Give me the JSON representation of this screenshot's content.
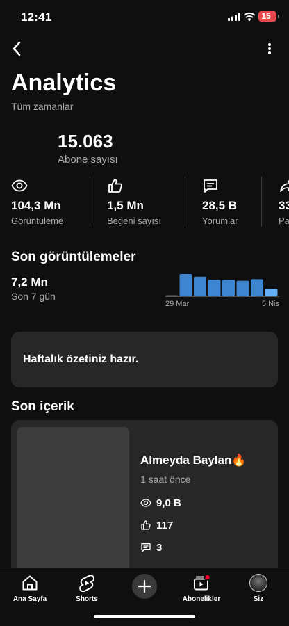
{
  "status_bar": {
    "time": "12:41",
    "battery": "15"
  },
  "header": {
    "title": "Analytics",
    "subtitle": "Tüm zamanlar"
  },
  "subscribers": {
    "value": "15.063",
    "label": "Abone sayısı"
  },
  "stats": [
    {
      "icon": "eye-icon",
      "value": "104,3 Mn",
      "label": "Görüntüleme"
    },
    {
      "icon": "thumbs-up-icon",
      "value": "1,5 Mn",
      "label": "Beğeni sayısı"
    },
    {
      "icon": "comment-icon",
      "value": "28,5 B",
      "label": "Yorumlar"
    },
    {
      "icon": "share-icon",
      "value": "33",
      "label": "Pa"
    }
  ],
  "recent_views": {
    "title": "Son görüntülemeler",
    "value": "7,2 Mn",
    "period": "Son 7 gün",
    "chart_data": {
      "type": "bar",
      "x_start_label": "29 Mar",
      "x_end_label": "5 Nis",
      "values": [
        0.05,
        1.0,
        0.88,
        0.74,
        0.74,
        0.7,
        0.77,
        0.33
      ],
      "bar_color": "#3e84cf",
      "highlight_color": "#65aef5"
    }
  },
  "summary": {
    "text": "Haftalık özetiniz hazır."
  },
  "recent_content": {
    "title": "Son içerik",
    "video_title": "Almeyda Baylan🔥",
    "time": "1 saat önce",
    "views": "9,0 B",
    "likes": "117",
    "comments": "3"
  },
  "bottom_nav": {
    "home": "Ana Sayfa",
    "shorts": "Shorts",
    "subscriptions": "Abonelikler",
    "you": "Siz"
  }
}
